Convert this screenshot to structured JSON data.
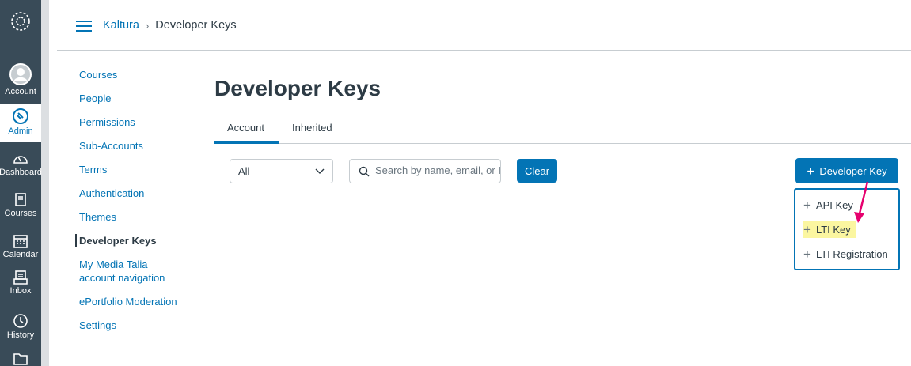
{
  "global_nav": {
    "items": [
      {
        "label": "Account",
        "icon": "account-icon"
      },
      {
        "label": "Admin",
        "icon": "admin-shield-icon"
      },
      {
        "label": "Dashboard",
        "icon": "dashboard-gauge-icon"
      },
      {
        "label": "Courses",
        "icon": "courses-book-icon"
      },
      {
        "label": "Calendar",
        "icon": "calendar-icon"
      },
      {
        "label": "Inbox",
        "icon": "inbox-icon"
      },
      {
        "label": "History",
        "icon": "history-clock-icon"
      }
    ]
  },
  "breadcrumb": {
    "parent": "Kaltura",
    "separator": "›",
    "current": "Developer Keys"
  },
  "sidebar": {
    "items": [
      {
        "label": "Courses"
      },
      {
        "label": "People"
      },
      {
        "label": "Permissions"
      },
      {
        "label": "Sub-Accounts"
      },
      {
        "label": "Terms"
      },
      {
        "label": "Authentication"
      },
      {
        "label": "Themes"
      },
      {
        "label": "Developer Keys"
      },
      {
        "label": "My Media Talia account navigation"
      },
      {
        "label": "ePortfolio Moderation"
      },
      {
        "label": "Settings"
      }
    ]
  },
  "main": {
    "title": "Developer Keys",
    "tabs": [
      {
        "label": "Account"
      },
      {
        "label": "Inherited"
      }
    ],
    "filter": {
      "selected": "All"
    },
    "search": {
      "placeholder": "Search by name, email, or ID"
    },
    "clear_label": "Clear",
    "add_button": {
      "label": "Developer Key"
    },
    "menu": {
      "items": [
        {
          "label": "API Key"
        },
        {
          "label": "LTI Key"
        },
        {
          "label": "LTI Registration"
        }
      ]
    }
  },
  "colors": {
    "nav_bg": "#394b58",
    "link": "#0374b5",
    "primary_button": "#0374b5",
    "highlight": "#fbf6a0",
    "annotation_arrow": "#e6006e"
  }
}
